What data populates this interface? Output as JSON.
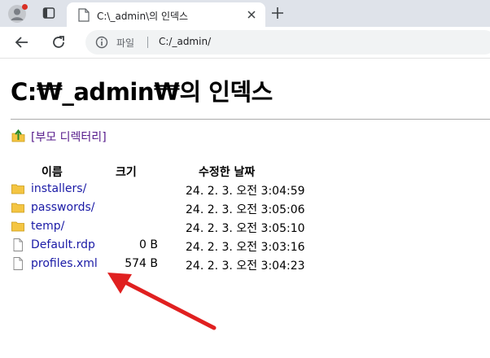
{
  "browser": {
    "tab_title": "C:\\_admin\\의 인덱스",
    "address_scheme": "파일",
    "address_url": "C:/_admin/"
  },
  "page": {
    "heading": "C:₩_admin₩의 인덱스",
    "parent_link": "[부모 디렉터리]",
    "columns": {
      "name": "이름",
      "size": "크기",
      "modified": "수정한 날짜"
    },
    "entries": [
      {
        "name": "installers/",
        "size": "",
        "modified": "24. 2. 3. 오전 3:04:59",
        "type": "folder"
      },
      {
        "name": "passwords/",
        "size": "",
        "modified": "24. 2. 3. 오전 3:05:06",
        "type": "folder"
      },
      {
        "name": "temp/",
        "size": "",
        "modified": "24. 2. 3. 오전 3:05:10",
        "type": "folder"
      },
      {
        "name": "Default.rdp",
        "size": "0 B",
        "modified": "24. 2. 3. 오전 3:03:16",
        "type": "file"
      },
      {
        "name": "profiles.xml",
        "size": "574 B",
        "modified": "24. 2. 3. 오전 3:04:23",
        "type": "file"
      }
    ]
  },
  "colors": {
    "link": "#1a1aa6",
    "visited_link": "#551a8b",
    "annotation_arrow": "#e02020",
    "folder": "#f4c542"
  }
}
